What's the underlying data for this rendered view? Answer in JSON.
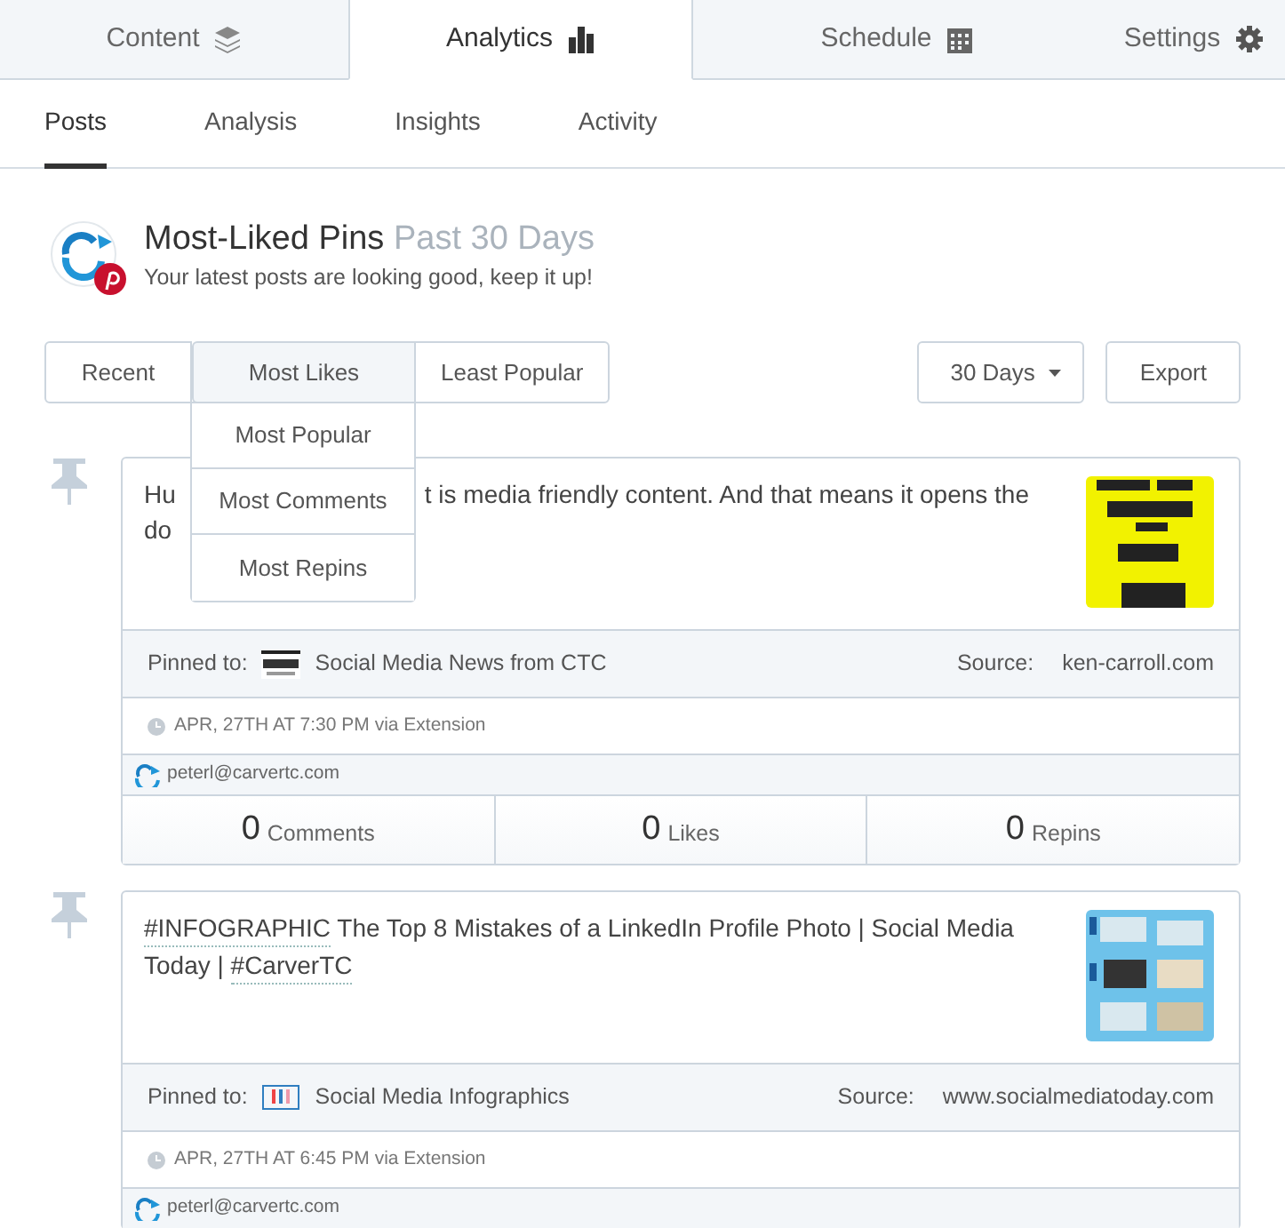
{
  "top_tabs": [
    {
      "label": "Content",
      "selected": false
    },
    {
      "label": "Analytics",
      "selected": true
    },
    {
      "label": "Schedule",
      "selected": false
    },
    {
      "label": "Settings",
      "selected": false
    }
  ],
  "sub_tabs": [
    {
      "label": "Posts",
      "selected": true
    },
    {
      "label": "Analysis",
      "selected": false
    },
    {
      "label": "Insights",
      "selected": false
    },
    {
      "label": "Activity",
      "selected": false
    }
  ],
  "header": {
    "title": "Most-Liked Pins",
    "period": "Past 30 Days",
    "subtitle": "Your latest posts are looking good, keep it up!"
  },
  "filters": [
    {
      "label": "Recent",
      "selected": false
    },
    {
      "label": "Most Likes",
      "selected": true,
      "menu": [
        "Most Popular",
        "Most Comments",
        "Most Repins"
      ]
    },
    {
      "label": "Least Popular",
      "selected": false
    }
  ],
  "range": {
    "value": "30 Days"
  },
  "export_button": "Export",
  "posts": [
    {
      "text_lines": [
        [
          {
            "text": "Hu",
            "kind": "plain"
          },
          {
            "text": "t is media friendly content. And that means it opens the",
            "kind": "plain",
            "covered_before": true
          }
        ],
        [
          {
            "text": "do",
            "kind": "plain"
          }
        ]
      ],
      "pinned_label": "Pinned to:",
      "board": "Social Media News from CTC",
      "source_label": "Source:",
      "source": "ken-carroll.com",
      "time": "APR, 27TH AT 7:30 PM via Extension",
      "user": "peterl@carvertc.com",
      "stats": [
        {
          "count": "0",
          "label": "Comments"
        },
        {
          "count": "0",
          "label": "Likes"
        },
        {
          "count": "0",
          "label": "Repins"
        }
      ]
    },
    {
      "text_lines": [
        [
          {
            "text": "#INFOGRAPHIC",
            "kind": "hashtag"
          },
          {
            "text": " The Top 8 Mistakes of a LinkedIn Profile Photo | Social Media",
            "kind": "plain"
          }
        ],
        [
          {
            "text": "Today | ",
            "kind": "plain"
          },
          {
            "text": "#CarverTC",
            "kind": "hashtag"
          }
        ]
      ],
      "pinned_label": "Pinned to:",
      "board": "Social Media Infographics",
      "source_label": "Source:",
      "source": "www.socialmediatoday.com",
      "time": "APR, 27TH AT 6:45 PM via Extension",
      "user": "peterl@carvertc.com"
    }
  ]
}
